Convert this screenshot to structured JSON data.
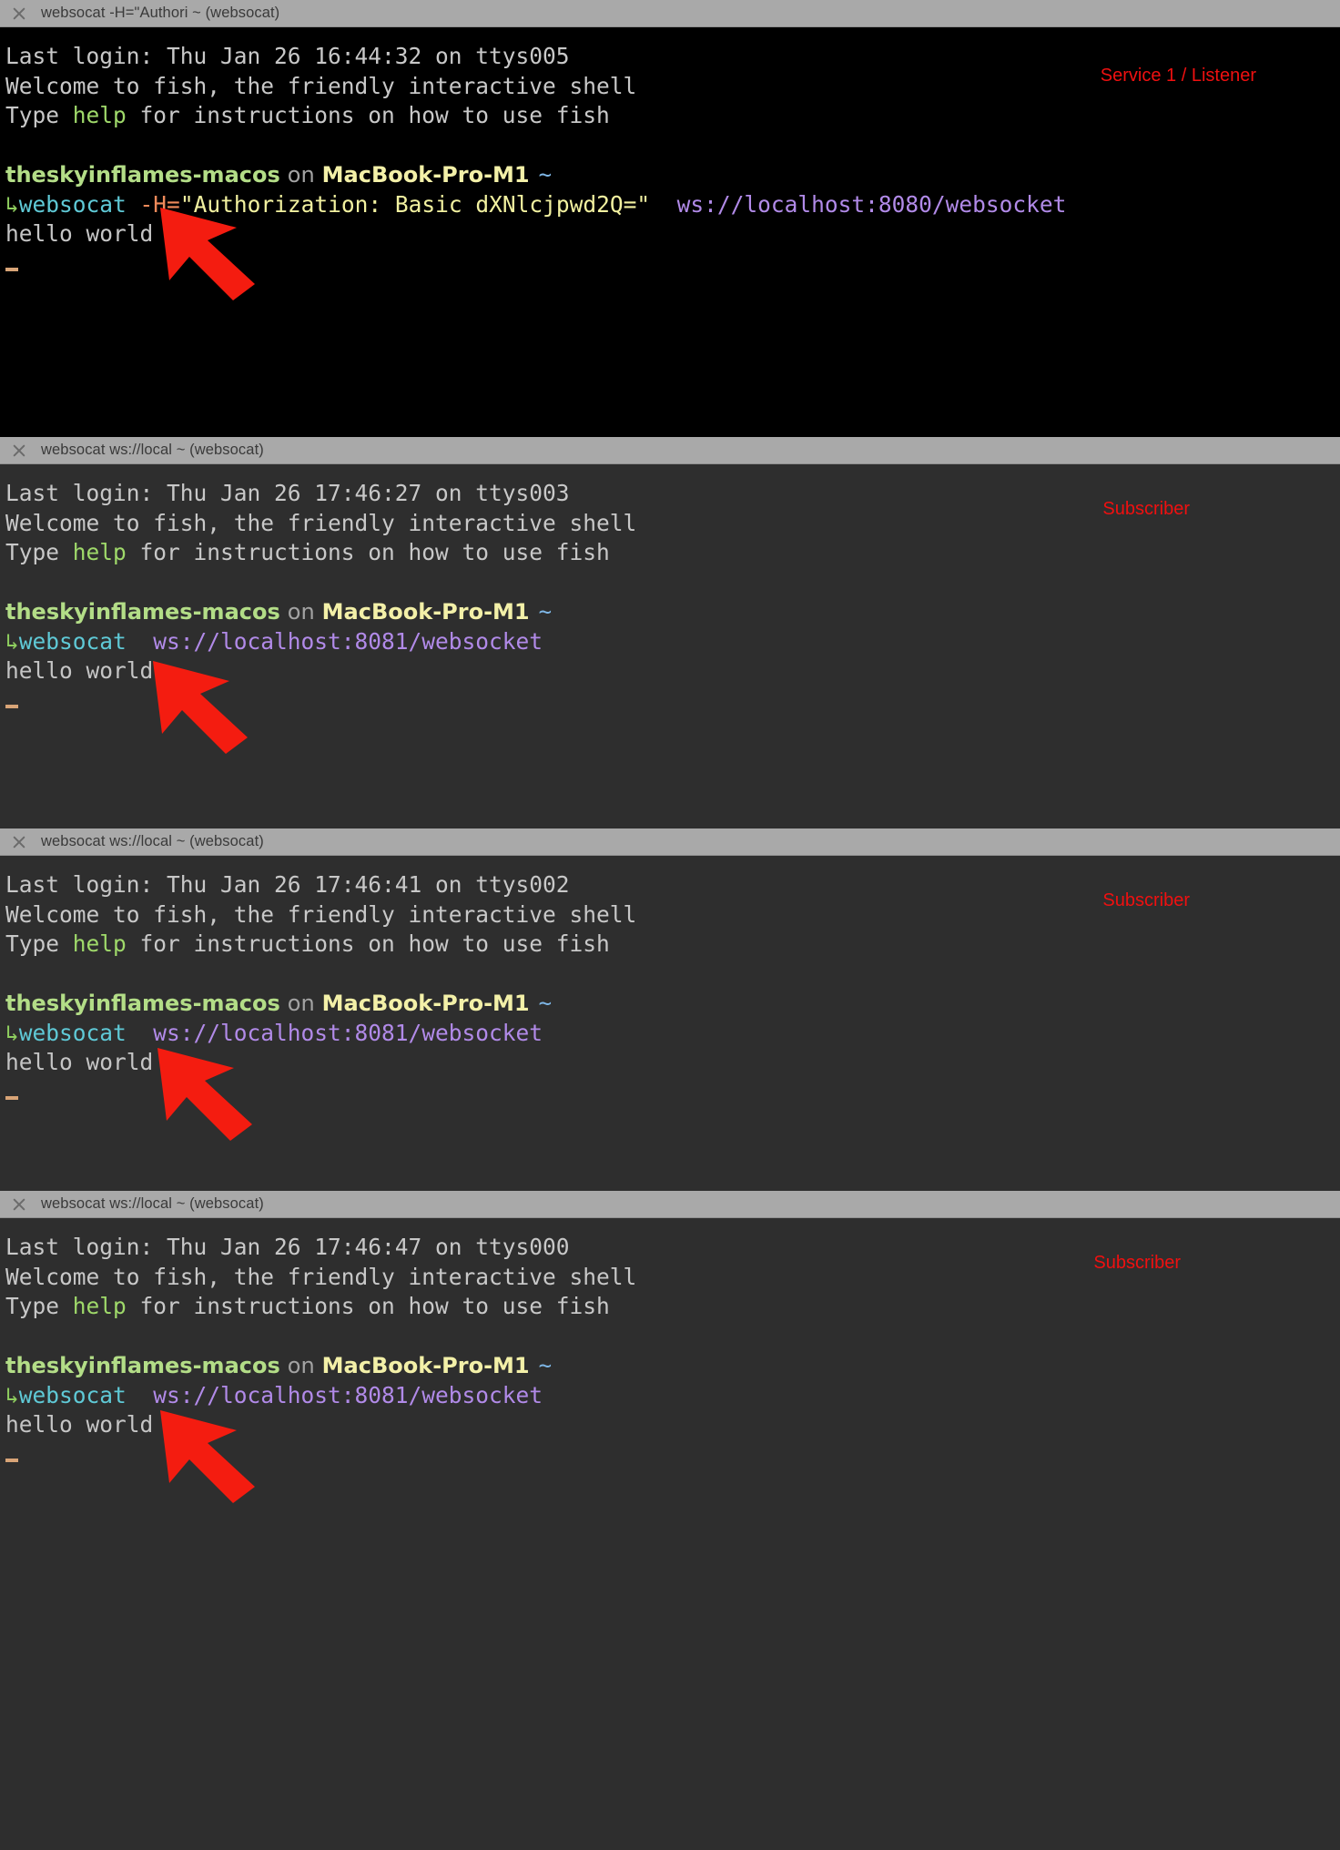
{
  "meta": {
    "accent_red": "#f01010",
    "title_bar_bg": "#a9a9a9",
    "terminal_black": "#000000",
    "terminal_grey": "#2e2e2e"
  },
  "panels": [
    {
      "id": "panel-1",
      "title": "websocat -H=\"Authori ~ (websocat)",
      "background": "black",
      "annotation": "Service 1 / Listener",
      "last_login": "Last login: Thu Jan 26 16:44:32 on ttys005",
      "welcome": "Welcome to fish, the friendly interactive shell",
      "type_prefix": "Type ",
      "type_help": "help",
      "type_suffix": " for instructions on how to use fish",
      "prompt_host": "theskyinflames-macos",
      "prompt_on": "on",
      "prompt_machine": "MacBook-Pro-M1",
      "prompt_tilde": "~",
      "cmd_arrow": "↳",
      "cmd_name": "websocat",
      "cmd_flag": "-H=",
      "cmd_header": "\"Authorization: Basic dXNlcjpwd2Q=\"",
      "cmd_url": "ws://localhost:8080/websocket",
      "output": "hello world"
    },
    {
      "id": "panel-2",
      "title": "websocat ws://local ~ (websocat)",
      "background": "grey",
      "annotation": "Subscriber",
      "last_login": "Last login: Thu Jan 26 17:46:27 on ttys003",
      "welcome": "Welcome to fish, the friendly interactive shell",
      "type_prefix": "Type ",
      "type_help": "help",
      "type_suffix": " for instructions on how to use fish",
      "prompt_host": "theskyinflames-macos",
      "prompt_on": "on",
      "prompt_machine": "MacBook-Pro-M1",
      "prompt_tilde": "~",
      "cmd_arrow": "↳",
      "cmd_name": "websocat",
      "cmd_flag": "",
      "cmd_header": "",
      "cmd_url": "ws://localhost:8081/websocket",
      "output": "hello world"
    },
    {
      "id": "panel-3",
      "title": "websocat ws://local ~ (websocat)",
      "background": "grey",
      "annotation": "Subscriber",
      "last_login": "Last login: Thu Jan 26 17:46:41 on ttys002",
      "welcome": "Welcome to fish, the friendly interactive shell",
      "type_prefix": "Type ",
      "type_help": "help",
      "type_suffix": " for instructions on how to use fish",
      "prompt_host": "theskyinflames-macos",
      "prompt_on": "on",
      "prompt_machine": "MacBook-Pro-M1",
      "prompt_tilde": "~",
      "cmd_arrow": "↳",
      "cmd_name": "websocat",
      "cmd_flag": "",
      "cmd_header": "",
      "cmd_url": "ws://localhost:8081/websocket",
      "output": "hello world"
    },
    {
      "id": "panel-4",
      "title": "websocat ws://local ~ (websocat)",
      "background": "grey",
      "annotation": "Subscriber",
      "last_login": "Last login: Thu Jan 26 17:46:47 on ttys000",
      "welcome": "Welcome to fish, the friendly interactive shell",
      "type_prefix": "Type ",
      "type_help": "help",
      "type_suffix": " for instructions on how to use fish",
      "prompt_host": "theskyinflames-macos",
      "prompt_on": "on",
      "prompt_machine": "MacBook-Pro-M1",
      "prompt_tilde": "~",
      "cmd_arrow": "↳",
      "cmd_name": "websocat",
      "cmd_flag": "",
      "cmd_header": "",
      "cmd_url": "ws://localhost:8081/websocket",
      "output": "hello world"
    }
  ]
}
